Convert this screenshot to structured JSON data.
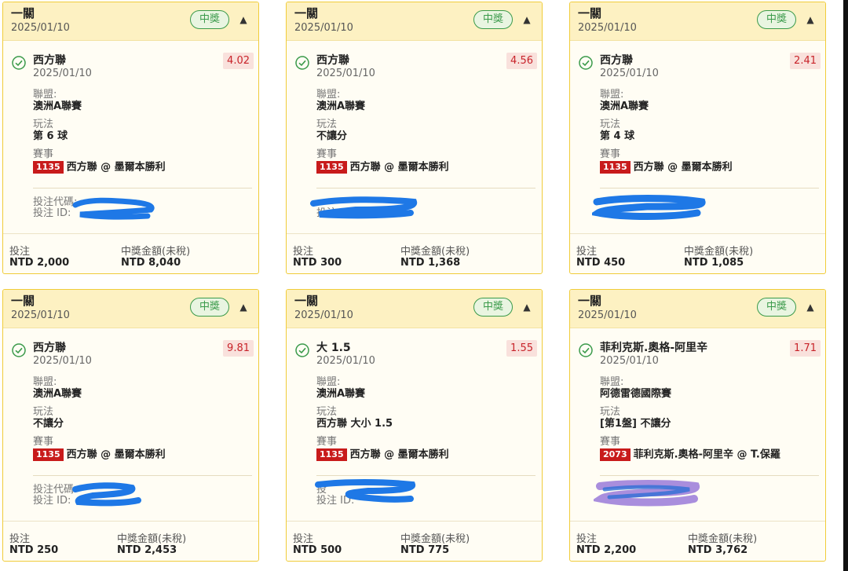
{
  "cards": [
    {
      "header_title": "一關",
      "header_date": "2025/01/10",
      "status": "中獎",
      "selection": "西方聯",
      "selection_date": "2025/01/10",
      "odds": "4.02",
      "league_label": "聯盟:",
      "league": "澳洲A聯賽",
      "play_label": "玩法",
      "play": "第 6 球",
      "event_label": "賽事",
      "event_id": "1135",
      "event_name": "西方聯 @ 墨爾本勝利",
      "code_label": "投注代碼:",
      "bet_id_label": "投注 ID:",
      "stake_label": "投注",
      "stake": "NTD 2,000",
      "payout_label": "中獎金額(未稅)",
      "payout": "NTD 8,040"
    },
    {
      "header_title": "一關",
      "header_date": "2025/01/10",
      "status": "中獎",
      "selection": "西方聯",
      "selection_date": "2025/01/10",
      "odds": "4.56",
      "league_label": "聯盟:",
      "league": "澳洲A聯賽",
      "play_label": "玩法",
      "play": "不讓分",
      "event_label": "賽事",
      "event_id": "1135",
      "event_name": "西方聯 @ 墨爾本勝利",
      "code_label": "",
      "bet_id_label": "投注 ID:",
      "stake_label": "投注",
      "stake": "NTD 300",
      "payout_label": "中獎金額(未稅)",
      "payout": "NTD 1,368"
    },
    {
      "header_title": "一關",
      "header_date": "2025/01/10",
      "status": "中獎",
      "selection": "西方聯",
      "selection_date": "2025/01/10",
      "odds": "2.41",
      "league_label": "聯盟:",
      "league": "澳洲A聯賽",
      "play_label": "玩法",
      "play": "第 4 球",
      "event_label": "賽事",
      "event_id": "1135",
      "event_name": "西方聯 @ 墨爾本勝利",
      "code_label": "",
      "bet_id_label": "",
      "stake_label": "投注",
      "stake": "NTD 450",
      "payout_label": "中獎金額(未稅)",
      "payout": "NTD 1,085"
    },
    {
      "header_title": "一關",
      "header_date": "2025/01/10",
      "status": "中獎",
      "selection": "西方聯",
      "selection_date": "2025/01/10",
      "odds": "9.81",
      "league_label": "聯盟:",
      "league": "澳洲A聯賽",
      "play_label": "玩法",
      "play": "不讓分",
      "event_label": "賽事",
      "event_id": "1135",
      "event_name": "西方聯 @ 墨爾本勝利",
      "code_label": "投注代碼",
      "bet_id_label": "投注 ID:",
      "stake_label": "投注",
      "stake": "NTD 250",
      "payout_label": "中獎金額(未稅)",
      "payout": "NTD 2,453"
    },
    {
      "header_title": "一關",
      "header_date": "2025/01/10",
      "status": "中獎",
      "selection": "大 1.5",
      "selection_date": "2025/01/10",
      "odds": "1.55",
      "league_label": "聯盟:",
      "league": "澳洲A聯賽",
      "play_label": "玩法",
      "play": "西方聯 大小 1.5",
      "event_label": "賽事",
      "event_id": "1135",
      "event_name": "西方聯 @ 墨爾本勝利",
      "code_label": "投",
      "bet_id_label": "投注 ID:",
      "stake_label": "投注",
      "stake": "NTD 500",
      "payout_label": "中獎金額(未稅)",
      "payout": "NTD 775"
    },
    {
      "header_title": "一關",
      "header_date": "2025/01/10",
      "status": "中獎",
      "selection": "菲利克斯.奧格-阿里辛",
      "selection_date": "2025/01/10",
      "odds": "1.71",
      "league_label": "聯盟:",
      "league": "阿德雷德國際賽",
      "play_label": "玩法",
      "play": "[第1盤] 不讓分",
      "event_label": "賽事",
      "event_id": "2073",
      "event_name": "菲利克斯.奧格-阿里辛 @ T.保羅",
      "code_label": "",
      "bet_id_label": "",
      "stake_label": "投注",
      "stake": "NTD 2,200",
      "payout_label": "中獎金額(未稅)",
      "payout": "NTD 3,762"
    }
  ],
  "colors": {
    "header_bg": "#fdf1c2",
    "card_bg": "#fffdf4",
    "border": "#f0cc3a",
    "win_green": "#3a9a4a",
    "odds_red": "#c8242a",
    "event_red": "#c81b1b",
    "redaction_blue": "#1e78e6",
    "redaction_purple": "#9a7ad8"
  }
}
